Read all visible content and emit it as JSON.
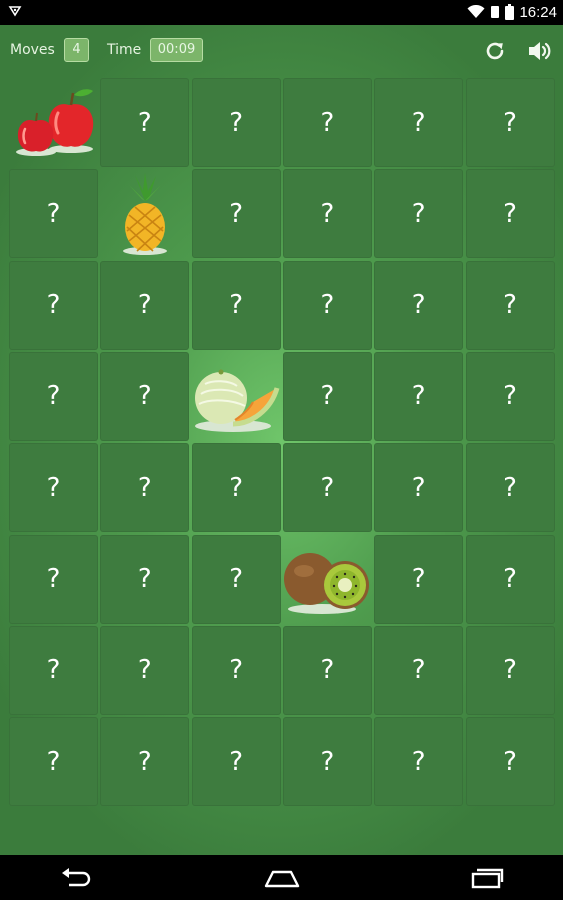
{
  "status_bar": {
    "time": "16:24",
    "icons": [
      "notification-icon",
      "wifi-icon",
      "sim-icon",
      "battery-icon"
    ]
  },
  "header": {
    "moves_label": "Moves",
    "moves_value": "4",
    "time_label": "Time",
    "time_value": "00:09",
    "restart_icon": "restart-icon",
    "sound_icon": "speaker-icon"
  },
  "board": {
    "columns": 6,
    "rows": 8,
    "hidden_symbol": "?",
    "revealed": [
      {
        "row": 0,
        "col": 0,
        "fruit": "apple"
      },
      {
        "row": 1,
        "col": 1,
        "fruit": "pineapple"
      },
      {
        "row": 3,
        "col": 2,
        "fruit": "melon"
      },
      {
        "row": 5,
        "col": 3,
        "fruit": "kiwi"
      }
    ]
  },
  "nav_bar": {
    "icons": [
      "back-icon",
      "home-icon",
      "recents-icon"
    ]
  },
  "colors": {
    "card_face_down": "#3e7c3f",
    "background_center": "#6fc56a",
    "background_edge": "#3b7c3c",
    "pill": "#7cb56a"
  }
}
